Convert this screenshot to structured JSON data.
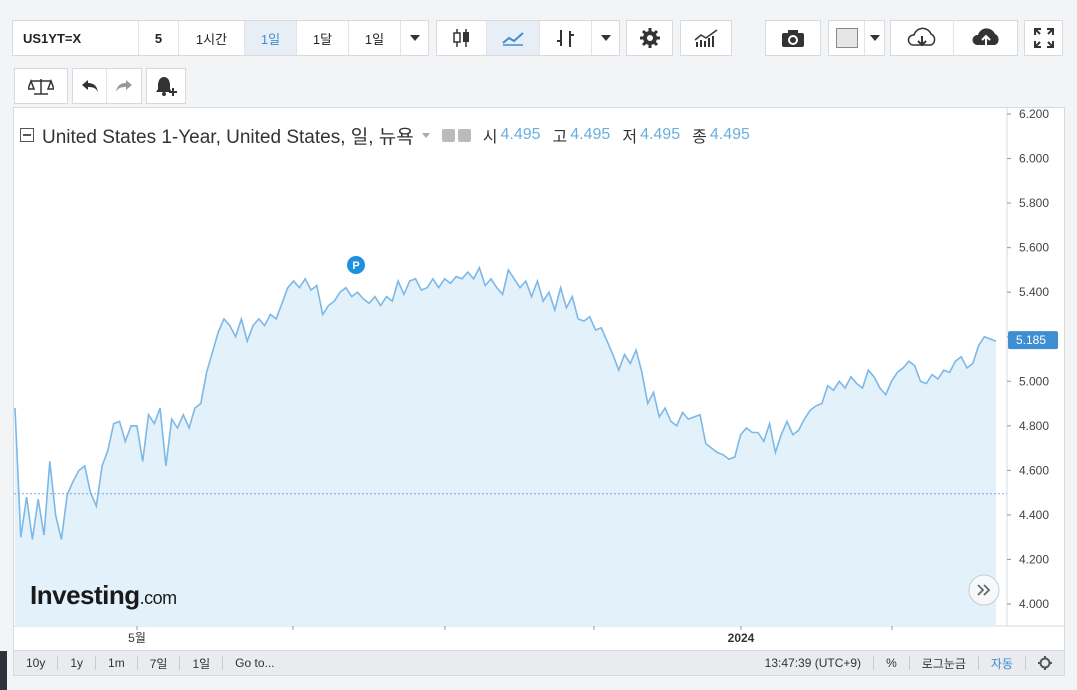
{
  "toolbar": {
    "symbol": "US1YT=X",
    "interval_5": "5",
    "interval_1h": "1시간",
    "interval_1d": "1일",
    "interval_1mo": "1달",
    "interval_sel": "1일"
  },
  "legend": {
    "title": "United States 1-Year, United States, 일, 뉴욕",
    "open_label": "시",
    "open": "4.495",
    "high_label": "고",
    "high": "4.495",
    "low_label": "저",
    "low": "4.495",
    "close_label": "종",
    "close": "4.495"
  },
  "chart_data": {
    "type": "area",
    "y_ticks": [
      "4.000",
      "4.200",
      "4.400",
      "4.600",
      "4.800",
      "5.000",
      "5.200",
      "5.400",
      "5.600",
      "5.800",
      "6.000",
      "6.200"
    ],
    "x_ticks": [
      "5월",
      "2024"
    ],
    "ylim": [
      3.95,
      6.22
    ],
    "last_price": "5.185",
    "reference_line": 4.495,
    "marker_label": "P",
    "line_color": "#7db8e6",
    "fill_color": "#e3f1fb",
    "values": [
      4.88,
      4.3,
      4.48,
      4.29,
      4.47,
      4.31,
      4.64,
      4.4,
      4.29,
      4.49,
      4.55,
      4.6,
      4.62,
      4.5,
      4.44,
      4.62,
      4.69,
      4.81,
      4.82,
      4.73,
      4.8,
      4.8,
      4.64,
      4.85,
      4.81,
      4.88,
      4.62,
      4.83,
      4.79,
      4.85,
      4.79,
      4.88,
      4.9,
      5.04,
      5.13,
      5.22,
      5.28,
      5.25,
      5.2,
      5.28,
      5.18,
      5.25,
      5.28,
      5.25,
      5.3,
      5.28,
      5.35,
      5.42,
      5.45,
      5.42,
      5.46,
      5.41,
      5.43,
      5.3,
      5.34,
      5.36,
      5.4,
      5.42,
      5.38,
      5.4,
      5.37,
      5.35,
      5.38,
      5.34,
      5.38,
      5.36,
      5.45,
      5.39,
      5.45,
      5.46,
      5.41,
      5.42,
      5.46,
      5.42,
      5.46,
      5.44,
      5.47,
      5.46,
      5.49,
      5.46,
      5.51,
      5.43,
      5.46,
      5.42,
      5.39,
      5.5,
      5.46,
      5.42,
      5.45,
      5.38,
      5.45,
      5.36,
      5.4,
      5.32,
      5.42,
      5.33,
      5.38,
      5.28,
      5.27,
      5.29,
      5.23,
      5.24,
      5.18,
      5.12,
      5.05,
      5.12,
      5.08,
      5.14,
      5.04,
      4.9,
      4.95,
      4.84,
      4.88,
      4.82,
      4.8,
      4.86,
      4.83,
      4.84,
      4.85,
      4.72,
      4.7,
      4.68,
      4.67,
      4.65,
      4.66,
      4.76,
      4.79,
      4.77,
      4.77,
      4.73,
      4.81,
      4.68,
      4.76,
      4.82,
      4.76,
      4.78,
      4.83,
      4.87,
      4.89,
      4.9,
      4.98,
      4.96,
      5.0,
      4.97,
      5.02,
      4.99,
      4.97,
      5.05,
      5.02,
      4.97,
      4.94,
      5.0,
      5.04,
      5.06,
      5.09,
      5.07,
      5.0,
      4.99,
      5.03,
      5.01,
      5.05,
      5.04,
      5.09,
      5.11,
      5.06,
      5.08,
      5.16,
      5.2,
      5.19,
      5.18
    ]
  },
  "bottom": {
    "r10y": "10y",
    "r1y": "1y",
    "r1m": "1m",
    "r7d": "7일",
    "r1d": "1일",
    "goto": "Go to...",
    "time": "13:47:39 (UTC+9)",
    "pct": "%",
    "log": "로그눈금",
    "auto": "자동"
  },
  "logo": {
    "main": "Investing",
    "suffix": ".com"
  }
}
